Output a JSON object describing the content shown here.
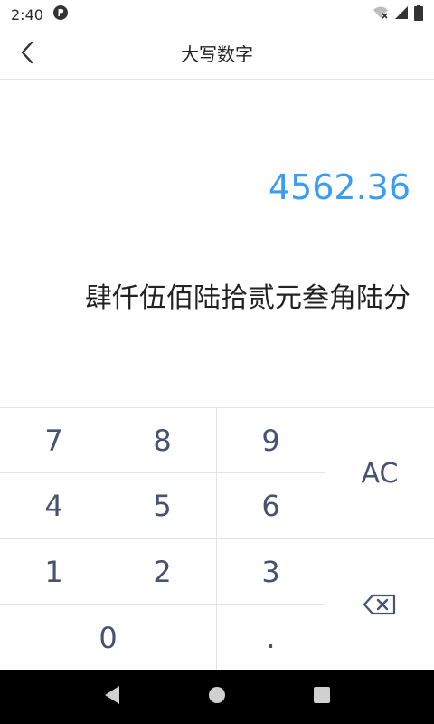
{
  "status": {
    "time": "2:40"
  },
  "header": {
    "title": "大写数字"
  },
  "display": {
    "number": "4562.36",
    "words": "肆仟伍佰陆拾贰元叁角陆分"
  },
  "keypad": {
    "k7": "7",
    "k8": "8",
    "k9": "9",
    "k4": "4",
    "k5": "5",
    "k6": "6",
    "k1": "1",
    "k2": "2",
    "k3": "3",
    "k0": "0",
    "dot": ".",
    "ac": "AC"
  },
  "colors": {
    "accent": "#3a9df3",
    "key_text": "#475172"
  },
  "icons": [
    "back-arrow-icon",
    "status-app-icon",
    "wifi-icon",
    "signal-icon",
    "battery-icon",
    "backspace-icon",
    "nav-back-icon",
    "nav-home-icon",
    "nav-recents-icon"
  ]
}
